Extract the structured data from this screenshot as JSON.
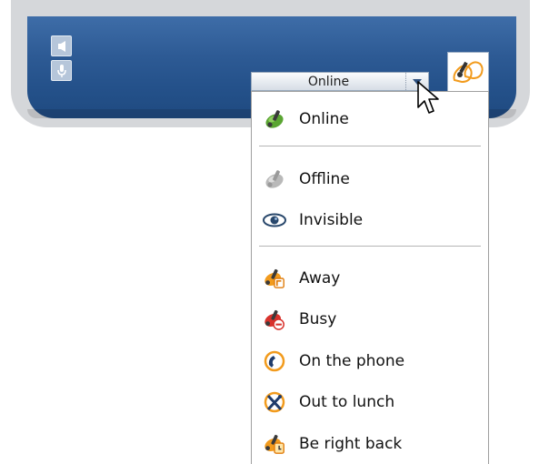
{
  "toolbar": {
    "speaker_icon": "speaker-icon",
    "microphone_icon": "microphone-icon",
    "status_value": "Online",
    "avatar_icon": "user-status-avatar-icon"
  },
  "status_menu": {
    "items": [
      {
        "label": "Online",
        "icon": "online-icon"
      },
      {
        "label": "Offline",
        "icon": "offline-icon"
      },
      {
        "label": "Invisible",
        "icon": "invisible-eye-icon"
      },
      {
        "label": "Away",
        "icon": "away-icon"
      },
      {
        "label": "Busy",
        "icon": "busy-icon"
      },
      {
        "label": "On the phone",
        "icon": "phone-icon"
      },
      {
        "label": "Out to lunch",
        "icon": "lunch-icon"
      },
      {
        "label": "Be right back",
        "icon": "be-right-back-icon"
      }
    ]
  },
  "colors": {
    "panel_blue": "#2d5a94",
    "chrome_gray": "#d5d7da",
    "online_green": "#5aa532",
    "away_orange": "#f29b1d",
    "busy_red": "#d8322c"
  }
}
